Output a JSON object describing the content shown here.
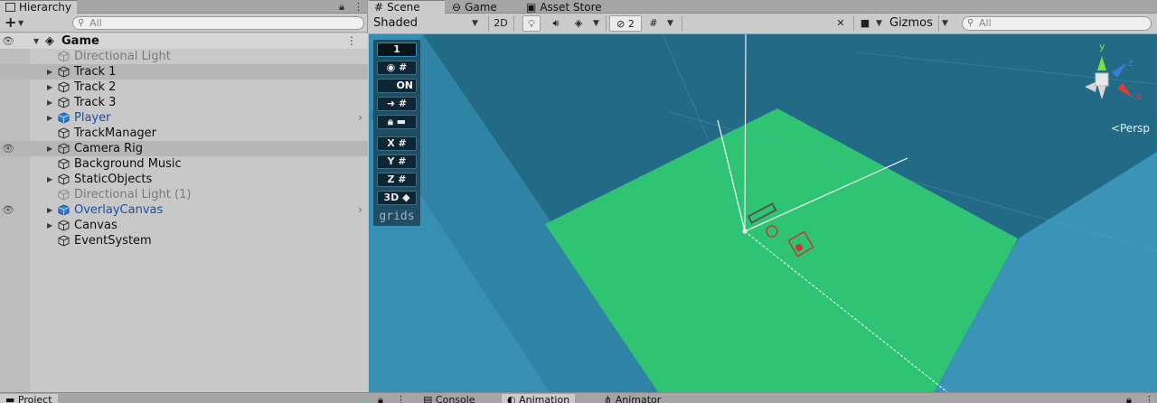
{
  "hierarchy": {
    "tab_label": "Hierarchy",
    "create_label": "+",
    "search_placeholder": "All",
    "rows": [
      {
        "label": "Game",
        "kind": "scene"
      },
      {
        "label": "Directional Light",
        "kind": "disabled"
      },
      {
        "label": "Track 1",
        "kind": "collapsed"
      },
      {
        "label": "Track 2",
        "kind": "collapsed"
      },
      {
        "label": "Track 3",
        "kind": "collapsed"
      },
      {
        "label": "Player",
        "kind": "prefab"
      },
      {
        "label": "TrackManager",
        "kind": "plain"
      },
      {
        "label": "Camera Rig",
        "kind": "collapsed"
      },
      {
        "label": "Background Music",
        "kind": "plain"
      },
      {
        "label": "StaticObjects",
        "kind": "collapsed"
      },
      {
        "label": "Directional Light (1)",
        "kind": "disabled"
      },
      {
        "label": "OverlayCanvas",
        "kind": "prefab"
      },
      {
        "label": "Canvas",
        "kind": "collapsed"
      },
      {
        "label": "EventSystem",
        "kind": "plain"
      }
    ]
  },
  "scene": {
    "tabs": [
      {
        "label": "Scene",
        "icon": "hash-icon",
        "active": true
      },
      {
        "label": "Game",
        "icon": "gamepad-icon",
        "active": false
      },
      {
        "label": "Asset Store",
        "icon": "store-bag-icon",
        "active": false
      }
    ],
    "toolbar": {
      "shading_mode": "Shaded",
      "mode_2d": "2D",
      "hidden_count": "2",
      "gizmos_label": "Gizmos",
      "search_placeholder": "All"
    },
    "grid_tools": {
      "grid_size": "1",
      "toggle_on": "ON",
      "x_label": "X",
      "y_label": "Y",
      "z_label": "Z",
      "mode_3d": "3D",
      "caption": "grids"
    },
    "gizmo": {
      "projection_label": "Persp",
      "axes": [
        {
          "label": "y",
          "color": "#7ae13a"
        },
        {
          "label": "z",
          "color": "#3a7de1"
        },
        {
          "label": "x",
          "color": "#e13a3a"
        }
      ]
    },
    "colors": {
      "background": "#246d8a",
      "ground": "#2ec473",
      "walls": "#3a91b4"
    }
  },
  "bottom_tabs": [
    {
      "label": "Project",
      "icon": "folder-icon"
    },
    {
      "label": "Console",
      "icon": "console-icon"
    },
    {
      "label": "Animation",
      "icon": "animation-icon"
    },
    {
      "label": "Animator",
      "icon": "animator-icon"
    }
  ]
}
